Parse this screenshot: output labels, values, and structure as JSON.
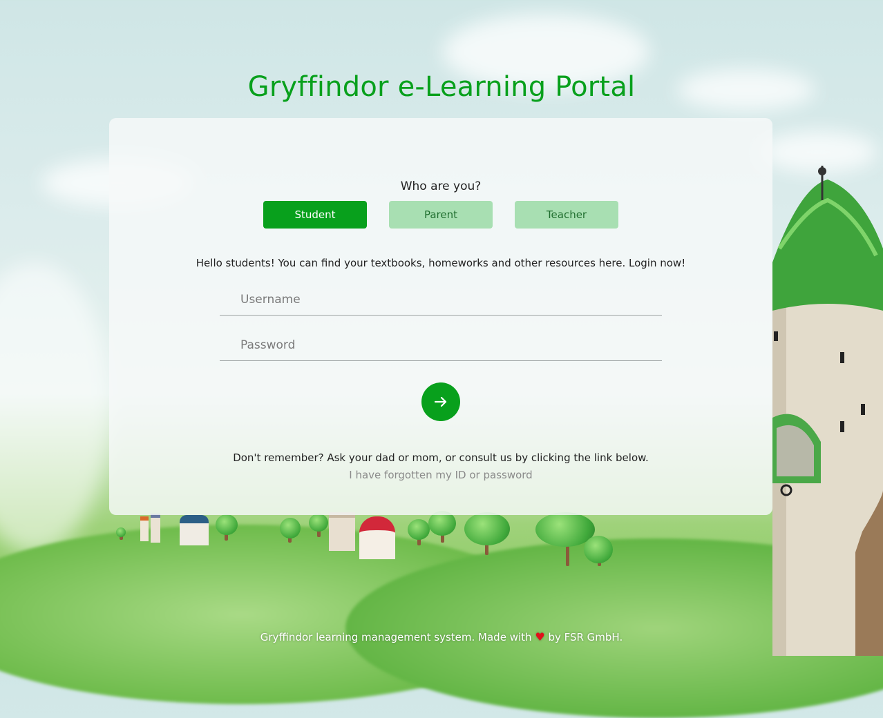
{
  "page": {
    "title": "Gryffindor e-Learning Portal"
  },
  "login": {
    "prompt": "Who are you?",
    "roles": [
      {
        "label": "Student",
        "active": true
      },
      {
        "label": "Parent",
        "active": false
      },
      {
        "label": "Teacher",
        "active": false
      }
    ],
    "greeting": "Hello students! You can find your textbooks, homeworks and other resources here. Login now!",
    "username_placeholder": "Username",
    "password_placeholder": "Password",
    "submit_icon": "arrow-right-icon",
    "remember_text": "Don't remember? Ask your dad or mom, or consult us by clicking the link below.",
    "forgot_link": "I have forgotten my ID or password"
  },
  "footer": {
    "text_before": "Gryffindor learning management system. Made with",
    "heart_icon": "heart-icon",
    "text_after": "by FSR GmbH."
  },
  "colors": {
    "accent": "#08a01c",
    "role_inactive_bg": "#a8dfb2",
    "role_inactive_text": "#1f6e2e",
    "heart": "#e0101a"
  }
}
